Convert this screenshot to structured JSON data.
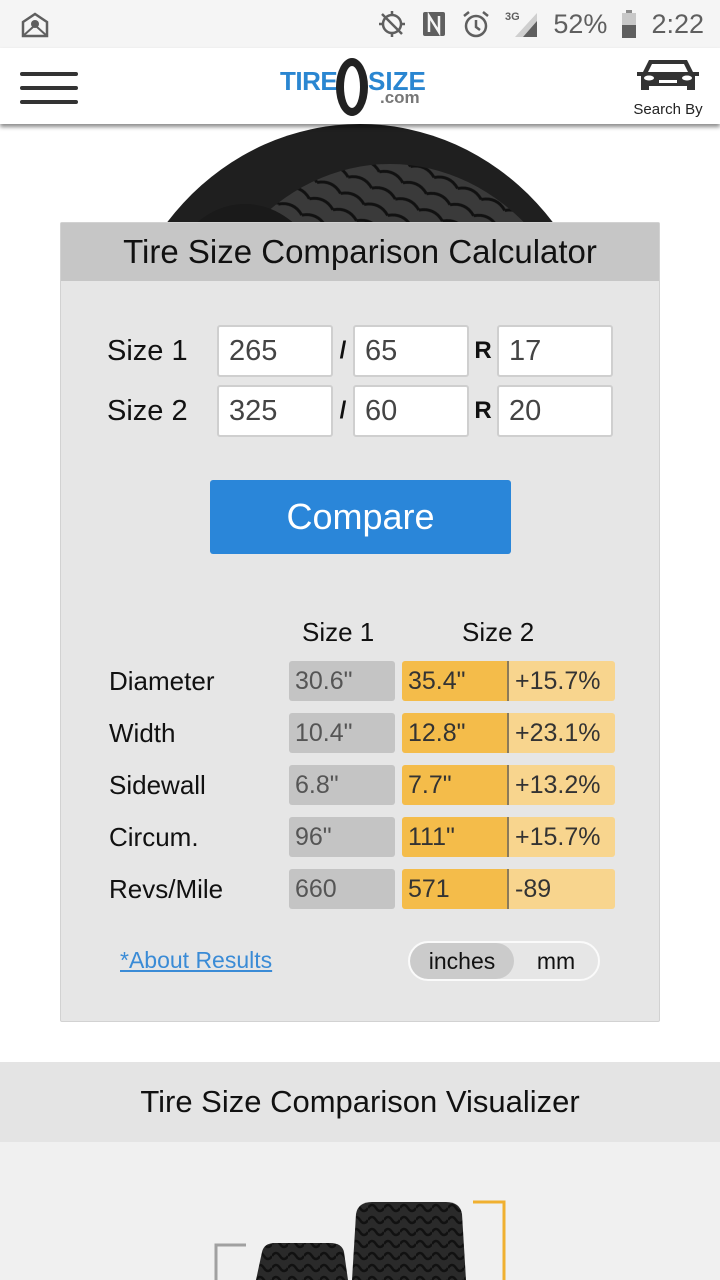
{
  "status_bar": {
    "notification_icon": "mail-icon",
    "icons": [
      "gps-off-icon",
      "nfc-icon",
      "alarm-icon",
      "signal-3g-icon"
    ],
    "network": "3G",
    "battery": "52%",
    "battery_level": 0.52,
    "time": "2:22"
  },
  "navbar": {
    "menu_icon": "hamburger-menu-icon",
    "logo": {
      "part1": "TIRE",
      "part2": "SIZE",
      "suffix": ".com"
    },
    "search_by_label": "Search By",
    "search_by_icon": "car-icon"
  },
  "calculator": {
    "title": "Tire Size Comparison Calculator",
    "sizes": [
      {
        "label": "Size 1",
        "width": "265",
        "aspect": "65",
        "rim": "17"
      },
      {
        "label": "Size 2",
        "width": "325",
        "aspect": "60",
        "rim": "20"
      }
    ],
    "separator_slash": "/",
    "separator_r": "R",
    "compare_label": "Compare",
    "results": {
      "headers": [
        "Size 1",
        "Size 2"
      ],
      "rows": [
        {
          "label": "Diameter",
          "size1": "30.6\"",
          "size2": "35.4\"",
          "diff": "+15.7%"
        },
        {
          "label": "Width",
          "size1": "10.4\"",
          "size2": "12.8\"",
          "diff": "+23.1%"
        },
        {
          "label": "Sidewall",
          "size1": "6.8\"",
          "size2": "7.7\"",
          "diff": "+13.2%"
        },
        {
          "label": "Circum.",
          "size1": "96\"",
          "size2": "111\"",
          "diff": "+15.7%"
        },
        {
          "label": "Revs/Mile",
          "size1": "660",
          "size2": "571",
          "diff": "-89"
        }
      ]
    },
    "about_link": "*About Results",
    "units": {
      "options": [
        "inches",
        "mm"
      ],
      "selected": "inches"
    }
  },
  "visualizer": {
    "title": "Tire Size Comparison Visualizer"
  },
  "colors": {
    "brand_blue": "#2a86d9",
    "size1_cell": "#c4c4c4",
    "size2_cell": "#f4bc4a",
    "diff_cell": "#f8d58e",
    "link": "#3a8bd6",
    "size2_bracket": "#f0b030"
  }
}
